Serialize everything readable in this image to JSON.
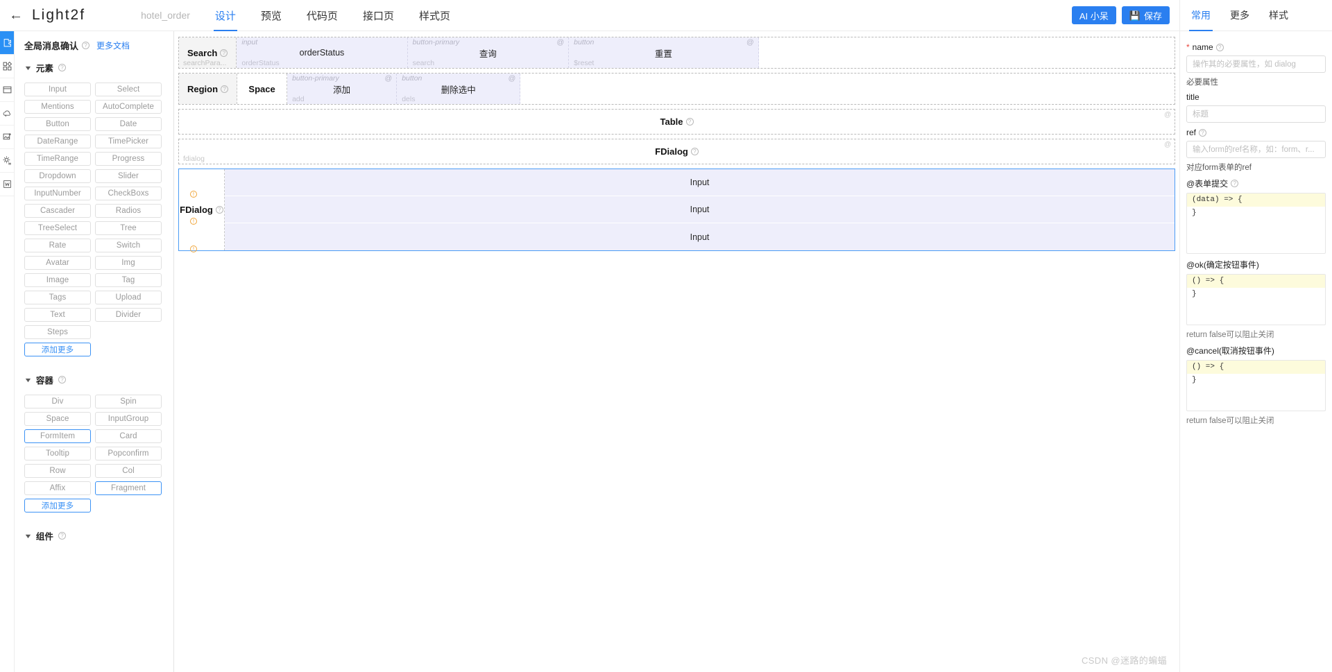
{
  "topbar": {
    "back_icon": "back-arrow-icon",
    "app_title": "Light2f",
    "project_name": "hotel_order",
    "tabs": [
      {
        "label": "设计",
        "active": true
      },
      {
        "label": "预览",
        "active": false
      },
      {
        "label": "代码页",
        "active": false
      },
      {
        "label": "接口页",
        "active": false
      },
      {
        "label": "样式页",
        "active": false
      }
    ],
    "ai_button": "AI 小呆",
    "save_button": "保存",
    "save_icon": "save-disk-icon"
  },
  "rail": {
    "items": [
      {
        "name": "puzzle-icon",
        "active": true
      },
      {
        "name": "grid-icon",
        "active": false
      },
      {
        "name": "window-icon",
        "active": false
      },
      {
        "name": "api-cloud-icon",
        "active": false
      },
      {
        "name": "image-add-icon",
        "active": false
      },
      {
        "name": "settings-gear-icon",
        "active": false
      },
      {
        "name": "word-doc-icon",
        "active": false
      }
    ]
  },
  "left_panel": {
    "header_title": "全局消息确认",
    "header_link": "更多文档",
    "sections": [
      {
        "title": "元素",
        "chips": [
          {
            "label": "Input",
            "selected": false
          },
          {
            "label": "Select",
            "selected": false
          },
          {
            "label": "Mentions",
            "selected": false
          },
          {
            "label": "AutoComplete",
            "selected": false
          },
          {
            "label": "Button",
            "selected": false
          },
          {
            "label": "Date",
            "selected": false
          },
          {
            "label": "DateRange",
            "selected": false
          },
          {
            "label": "TimePicker",
            "selected": false
          },
          {
            "label": "TimeRange",
            "selected": false
          },
          {
            "label": "Progress",
            "selected": false
          },
          {
            "label": "Dropdown",
            "selected": false
          },
          {
            "label": "Slider",
            "selected": false
          },
          {
            "label": "InputNumber",
            "selected": false
          },
          {
            "label": "CheckBoxs",
            "selected": false
          },
          {
            "label": "Cascader",
            "selected": false
          },
          {
            "label": "Radios",
            "selected": false
          },
          {
            "label": "TreeSelect",
            "selected": false
          },
          {
            "label": "Tree",
            "selected": false
          },
          {
            "label": "Rate",
            "selected": false
          },
          {
            "label": "Switch",
            "selected": false
          },
          {
            "label": "Avatar",
            "selected": false
          },
          {
            "label": "Img",
            "selected": false
          },
          {
            "label": "Image",
            "selected": false
          },
          {
            "label": "Tag",
            "selected": false
          },
          {
            "label": "Tags",
            "selected": false
          },
          {
            "label": "Upload",
            "selected": false
          },
          {
            "label": "Text",
            "selected": false
          },
          {
            "label": "Divider",
            "selected": false
          },
          {
            "label": "Steps",
            "selected": false
          }
        ],
        "more_label": "添加更多"
      },
      {
        "title": "容器",
        "chips": [
          {
            "label": "Div",
            "selected": false
          },
          {
            "label": "Spin",
            "selected": false
          },
          {
            "label": "Space",
            "selected": false
          },
          {
            "label": "InputGroup",
            "selected": false
          },
          {
            "label": "FormItem",
            "selected": true
          },
          {
            "label": "Card",
            "selected": false
          },
          {
            "label": "Tooltip",
            "selected": false
          },
          {
            "label": "Popconfirm",
            "selected": false
          },
          {
            "label": "Row",
            "selected": false
          },
          {
            "label": "Col",
            "selected": false
          },
          {
            "label": "Affix",
            "selected": false
          },
          {
            "label": "Fragment",
            "selected": true
          }
        ],
        "more_label": "添加更多"
      },
      {
        "title": "组件",
        "chips": [],
        "more_label": ""
      }
    ]
  },
  "canvas": {
    "search_row": {
      "label": "Search",
      "label_sub": "searchPara...",
      "slots": [
        {
          "tag_tl": "input",
          "tag_tr": "",
          "mid": "orderStatus",
          "tag_bl": "orderStatus"
        },
        {
          "tag_tl": "button-primary",
          "tag_tr": "@",
          "mid": "查询",
          "tag_bl": "search"
        },
        {
          "tag_tl": "button",
          "tag_tr": "@",
          "mid": "重置",
          "tag_bl": "$reset"
        }
      ]
    },
    "region_row": {
      "label": "Region",
      "space_label": "Space",
      "slots": [
        {
          "tag_tl": "button-primary",
          "tag_tr": "@",
          "mid": "添加",
          "tag_bl": "add"
        },
        {
          "tag_tl": "button",
          "tag_tr": "@",
          "mid": "删除选中",
          "tag_bl": "dels"
        }
      ]
    },
    "table_block": {
      "label": "Table",
      "at": "@",
      "sub": ""
    },
    "fdialog_block": {
      "label": "FDialog",
      "at": "@",
      "sub": "fdialog"
    },
    "fdialog_selected": {
      "label": "FDialog",
      "rows": [
        {
          "label": "Input"
        },
        {
          "label": "Input"
        },
        {
          "label": "Input"
        }
      ]
    }
  },
  "right_panel": {
    "tabs": [
      {
        "label": "常用",
        "active": true
      },
      {
        "label": "更多",
        "active": false
      },
      {
        "label": "样式",
        "active": false
      }
    ],
    "fields": [
      {
        "key": "name",
        "label": "name",
        "required": true,
        "has_help": true,
        "placeholder": "操作其的必要属性，如 dialog",
        "value": "",
        "hint": "必要属性"
      },
      {
        "key": "title",
        "label": "title",
        "required": false,
        "has_help": false,
        "placeholder": "标题",
        "value": "",
        "hint": ""
      },
      {
        "key": "ref",
        "label": "ref",
        "required": false,
        "has_help": true,
        "placeholder": "输入form的ref名称，如：form、r...",
        "value": "",
        "hint": "对应form表单的ref"
      }
    ],
    "code_fields": [
      {
        "label": "@表单提交",
        "has_help": true,
        "sig": "(data) => {",
        "close": "}",
        "hint": ""
      },
      {
        "label": "@ok(确定按钮事件)",
        "has_help": false,
        "sig": "() => {",
        "close": "}",
        "hint": "return false可以阻止关闭"
      },
      {
        "label": "@cancel(取消按钮事件)",
        "has_help": false,
        "sig": "() => {",
        "close": "}",
        "hint": "return false可以阻止关闭"
      }
    ]
  },
  "watermark": "CSDN @迷路的蝙蝠",
  "colors": {
    "accent": "#2a7ff0",
    "slot_bg": "#eeeefb",
    "selected_border": "#4a9bf5",
    "warn": "#f0a63c"
  }
}
